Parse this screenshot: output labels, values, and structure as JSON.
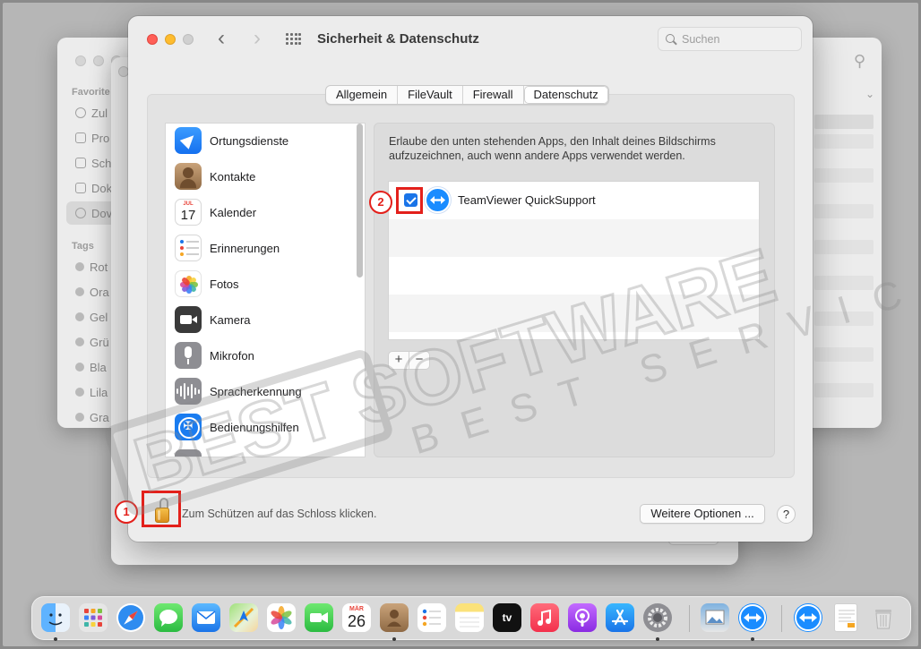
{
  "window": {
    "title": "Sicherheit & Datenschutz",
    "search_placeholder": "Suchen"
  },
  "tabs": [
    {
      "label": "Allgemein",
      "active": false
    },
    {
      "label": "FileVault",
      "active": false
    },
    {
      "label": "Firewall",
      "active": false
    },
    {
      "label": "Datenschutz",
      "active": true
    }
  ],
  "privacy_categories": [
    {
      "label": "Ortungsdienste",
      "icon": "location-arrow-icon"
    },
    {
      "label": "Kontakte",
      "icon": "contacts-icon"
    },
    {
      "label": "Kalender",
      "icon": "calendar-icon",
      "month": "JUL",
      "day": "17"
    },
    {
      "label": "Erinnerungen",
      "icon": "reminders-icon"
    },
    {
      "label": "Fotos",
      "icon": "photos-icon"
    },
    {
      "label": "Kamera",
      "icon": "camera-icon"
    },
    {
      "label": "Mikrofon",
      "icon": "microphone-icon"
    },
    {
      "label": "Spracherkennung",
      "icon": "waveform-icon"
    },
    {
      "label": "Bedienungshilfen",
      "icon": "accessibility-icon"
    }
  ],
  "detail": {
    "description": "Erlaube den unten stehenden Apps, den Inhalt deines Bildschirms aufzuzeichnen, auch wenn andere Apps verwendet werden.",
    "apps": [
      {
        "name": "TeamViewer QuickSupport",
        "checked": true
      }
    ],
    "add_label": "+",
    "remove_label": "−"
  },
  "footer": {
    "lock_text": "Zum Schützen auf das Schloss klicken.",
    "more_options": "Weitere Optionen ...",
    "help": "?"
  },
  "annotations": {
    "marker_1": "1",
    "marker_2": "2"
  },
  "watermark": {
    "line1": "BEST SOFTWARE",
    "line2": "BEST SERVICE"
  },
  "finder_sidebar": {
    "favorites_heading": "Favorite",
    "favorites": [
      "Zul",
      "Pro",
      "Sch",
      "Dok",
      "Dov"
    ],
    "tags_heading": "Tags",
    "tags": [
      "Rot",
      "Ora",
      "Gel",
      "Grü",
      "Bla",
      "Lila",
      "Gra"
    ]
  },
  "dock": {
    "calendar_month": "MÄR",
    "calendar_day": "26",
    "tv_label": "tv",
    "apps": [
      "finder-icon",
      "launchpad-icon",
      "safari-icon",
      "messages-icon",
      "mail-icon",
      "maps-icon",
      "photos-icon",
      "facetime-icon",
      "calendar-icon",
      "contacts-icon",
      "reminders-icon",
      "notes-icon",
      "apple-tv-icon",
      "music-icon",
      "podcasts-icon",
      "app-store-icon",
      "system-preferences-icon",
      "preview-icon",
      "teamviewer-icon",
      "teamviewer-icon",
      "document-icon",
      "trash-icon"
    ]
  },
  "colors": {
    "accent": "#1a74e8",
    "highlight": "#e3201b",
    "watermark": "#8a8a8a"
  }
}
